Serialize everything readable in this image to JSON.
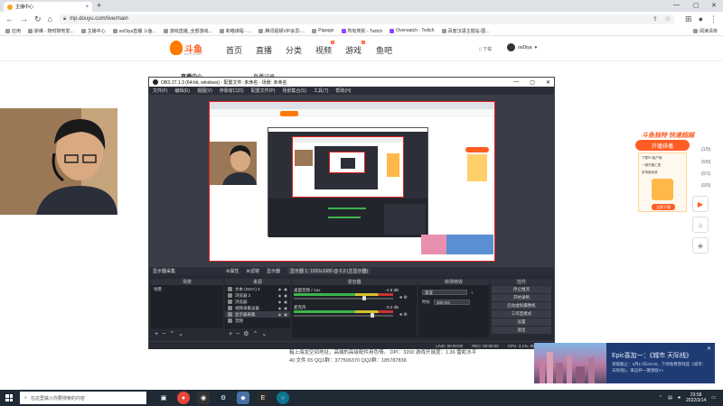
{
  "browser": {
    "tab_title": "主播中心",
    "url": "mp.douyu.com/live/main",
    "bookmarks": [
      "应用",
      "斯维 - 随时随地发...",
      "主播中心",
      "ooDiya直播 斗鱼...",
      "游戏直播_全部游戏...",
      "和喵课程 - ...",
      "腾讯视频VIP会员-...",
      "Papago",
      "所有类别 - Twitch",
      "Overwatch - Twitch",
      "百度汉语主题站·图..."
    ],
    "reading_list": "阅读清单"
  },
  "site": {
    "logo_text": "斗鱼",
    "logo_sub": "DOUYU.COM",
    "nav": [
      "首页",
      "直播",
      "分类",
      "视频",
      "游戏",
      "鱼吧"
    ],
    "download": "下载",
    "username": "ooDiya"
  },
  "page": {
    "room_label": "直播中心",
    "room_tab": "直播记录",
    "info_text": "箱上海龙空间地址，高端的高级配件用色情。 DPI：3200 游戏开鼠度：1.36 雷蛇水平 40 文件 65 QQ1群：377506370 QQ2群：185787838"
  },
  "ad": {
    "top": "斗鱼独特 快速超越",
    "bar": "开播排播",
    "lines": [
      "下载PC客户端",
      "一键开播工具",
      "多场景免费"
    ],
    "button": "立即下载",
    "counts": [
      "(1/0)",
      "(0/0)",
      "(0/1)",
      "(0/0)"
    ]
  },
  "obs": {
    "title": "OBS 27.1.3 (64-bit, windows) - 配置文件: 未命名 - 场景: 未命名",
    "menu": [
      "文件(F)",
      "编辑(E)",
      "视图(V)",
      "停靠窗口(D)",
      "配置文件(P)",
      "场景集合(S)",
      "工具(T)",
      "帮助(H)"
    ],
    "status_bar": [
      "显示器采集",
      "⚙属性",
      "⚙滤镜",
      "显示器",
      "显示器 1: 1920x1080 @ 0,0 (主显示器)"
    ],
    "panels": {
      "scenes": "场景",
      "sources": "来源",
      "mixer": "混音器",
      "transitions": "转场特效",
      "controls": "控件"
    },
    "scene_list": [
      "场景"
    ],
    "sources": [
      "文本 (GDI+) 2",
      "浏览器 2",
      "浏览器",
      "视频采集设备",
      "显示器采集",
      "音频"
    ],
    "mixer": [
      {
        "name": "桌面音频 / Aux",
        "db": "-4.8 dB",
        "knob": 0.72
      },
      {
        "name": "麦克风",
        "db": "-3.2 dB",
        "knob": 0.8
      }
    ],
    "transition_type": "渐变",
    "transition_label": "时长",
    "transition_value": "300 ms",
    "controls": [
      "停止推流",
      "开始录制",
      "启动虚拟摄像机",
      "工作室模式",
      "设置",
      "退出"
    ],
    "status": [
      "LIVE: 00:00:00",
      "REC: 00:00:00",
      "CPU: 3.1%, 60.00 fps"
    ]
  },
  "notification": {
    "title": "Epic喜加一：《城市 天际线》",
    "text": "领取截止：3月17日23:00。下周免费游戏是《城市：天际线》。来这杯一键领取>>"
  },
  "taskbar": {
    "search_placeholder": "在这里输入你要搜索的内容",
    "time": "23:58",
    "date": "2022/3/14"
  }
}
